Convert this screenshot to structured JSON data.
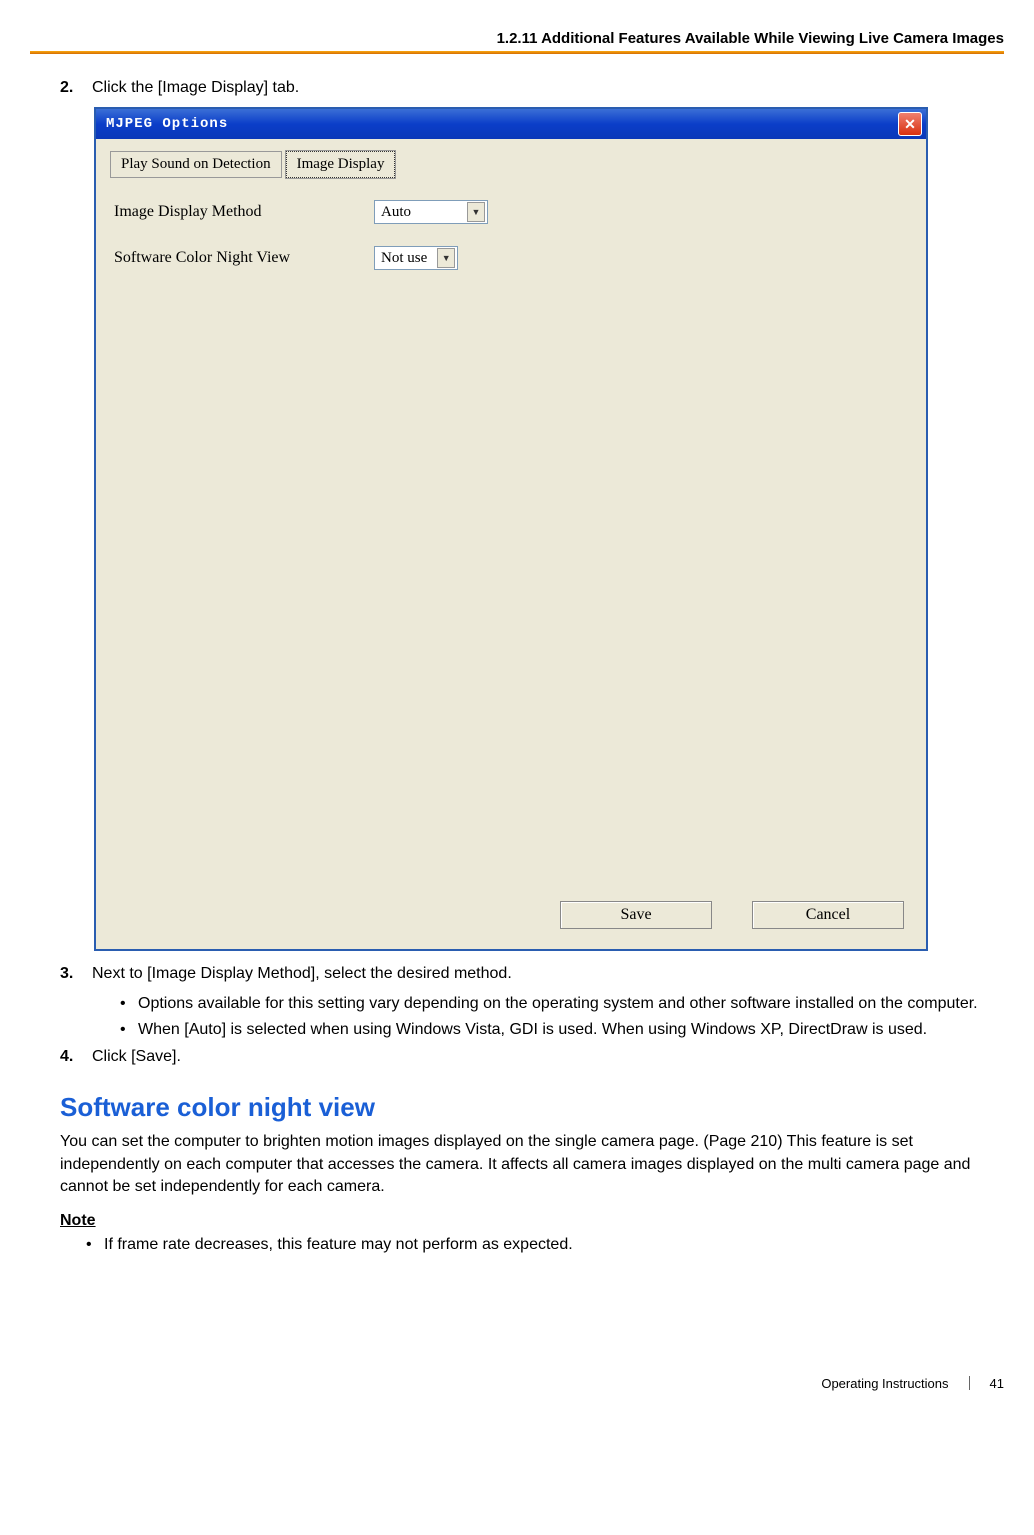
{
  "header": {
    "section_title": "1.2.11 Additional Features Available While Viewing Live Camera Images"
  },
  "steps": {
    "s2": {
      "num": "2.",
      "text": "Click the [Image Display] tab."
    },
    "s3": {
      "num": "3.",
      "text": "Next to [Image Display Method], select the desired method.",
      "bullets": {
        "b0": "Options available for this setting vary depending on the operating system and other software installed on the computer.",
        "b1": "When [Auto] is selected when using Windows Vista, GDI is used. When using Windows XP, DirectDraw is used."
      }
    },
    "s4": {
      "num": "4.",
      "text": "Click [Save]."
    }
  },
  "dialog": {
    "title": "MJPEG Options",
    "tabs": {
      "t0": "Play Sound on Detection",
      "t1": "Image Display"
    },
    "rows": {
      "r0": {
        "label": "Image Display Method",
        "value": "Auto"
      },
      "r1": {
        "label": "Software Color Night View",
        "value": "Not use"
      }
    },
    "buttons": {
      "save": "Save",
      "cancel": "Cancel"
    }
  },
  "section": {
    "heading": "Software color night view",
    "para": "You can set the computer to brighten motion images displayed on the single camera page. (Page 210) This feature is set independently on each computer that accesses the camera. It affects all camera images displayed on the multi camera page and cannot be set independently for each camera.",
    "note_label": "Note",
    "note_bullet": "If frame rate decreases, this feature may not perform as expected."
  },
  "footer": {
    "doc": "Operating Instructions",
    "page": "41"
  }
}
